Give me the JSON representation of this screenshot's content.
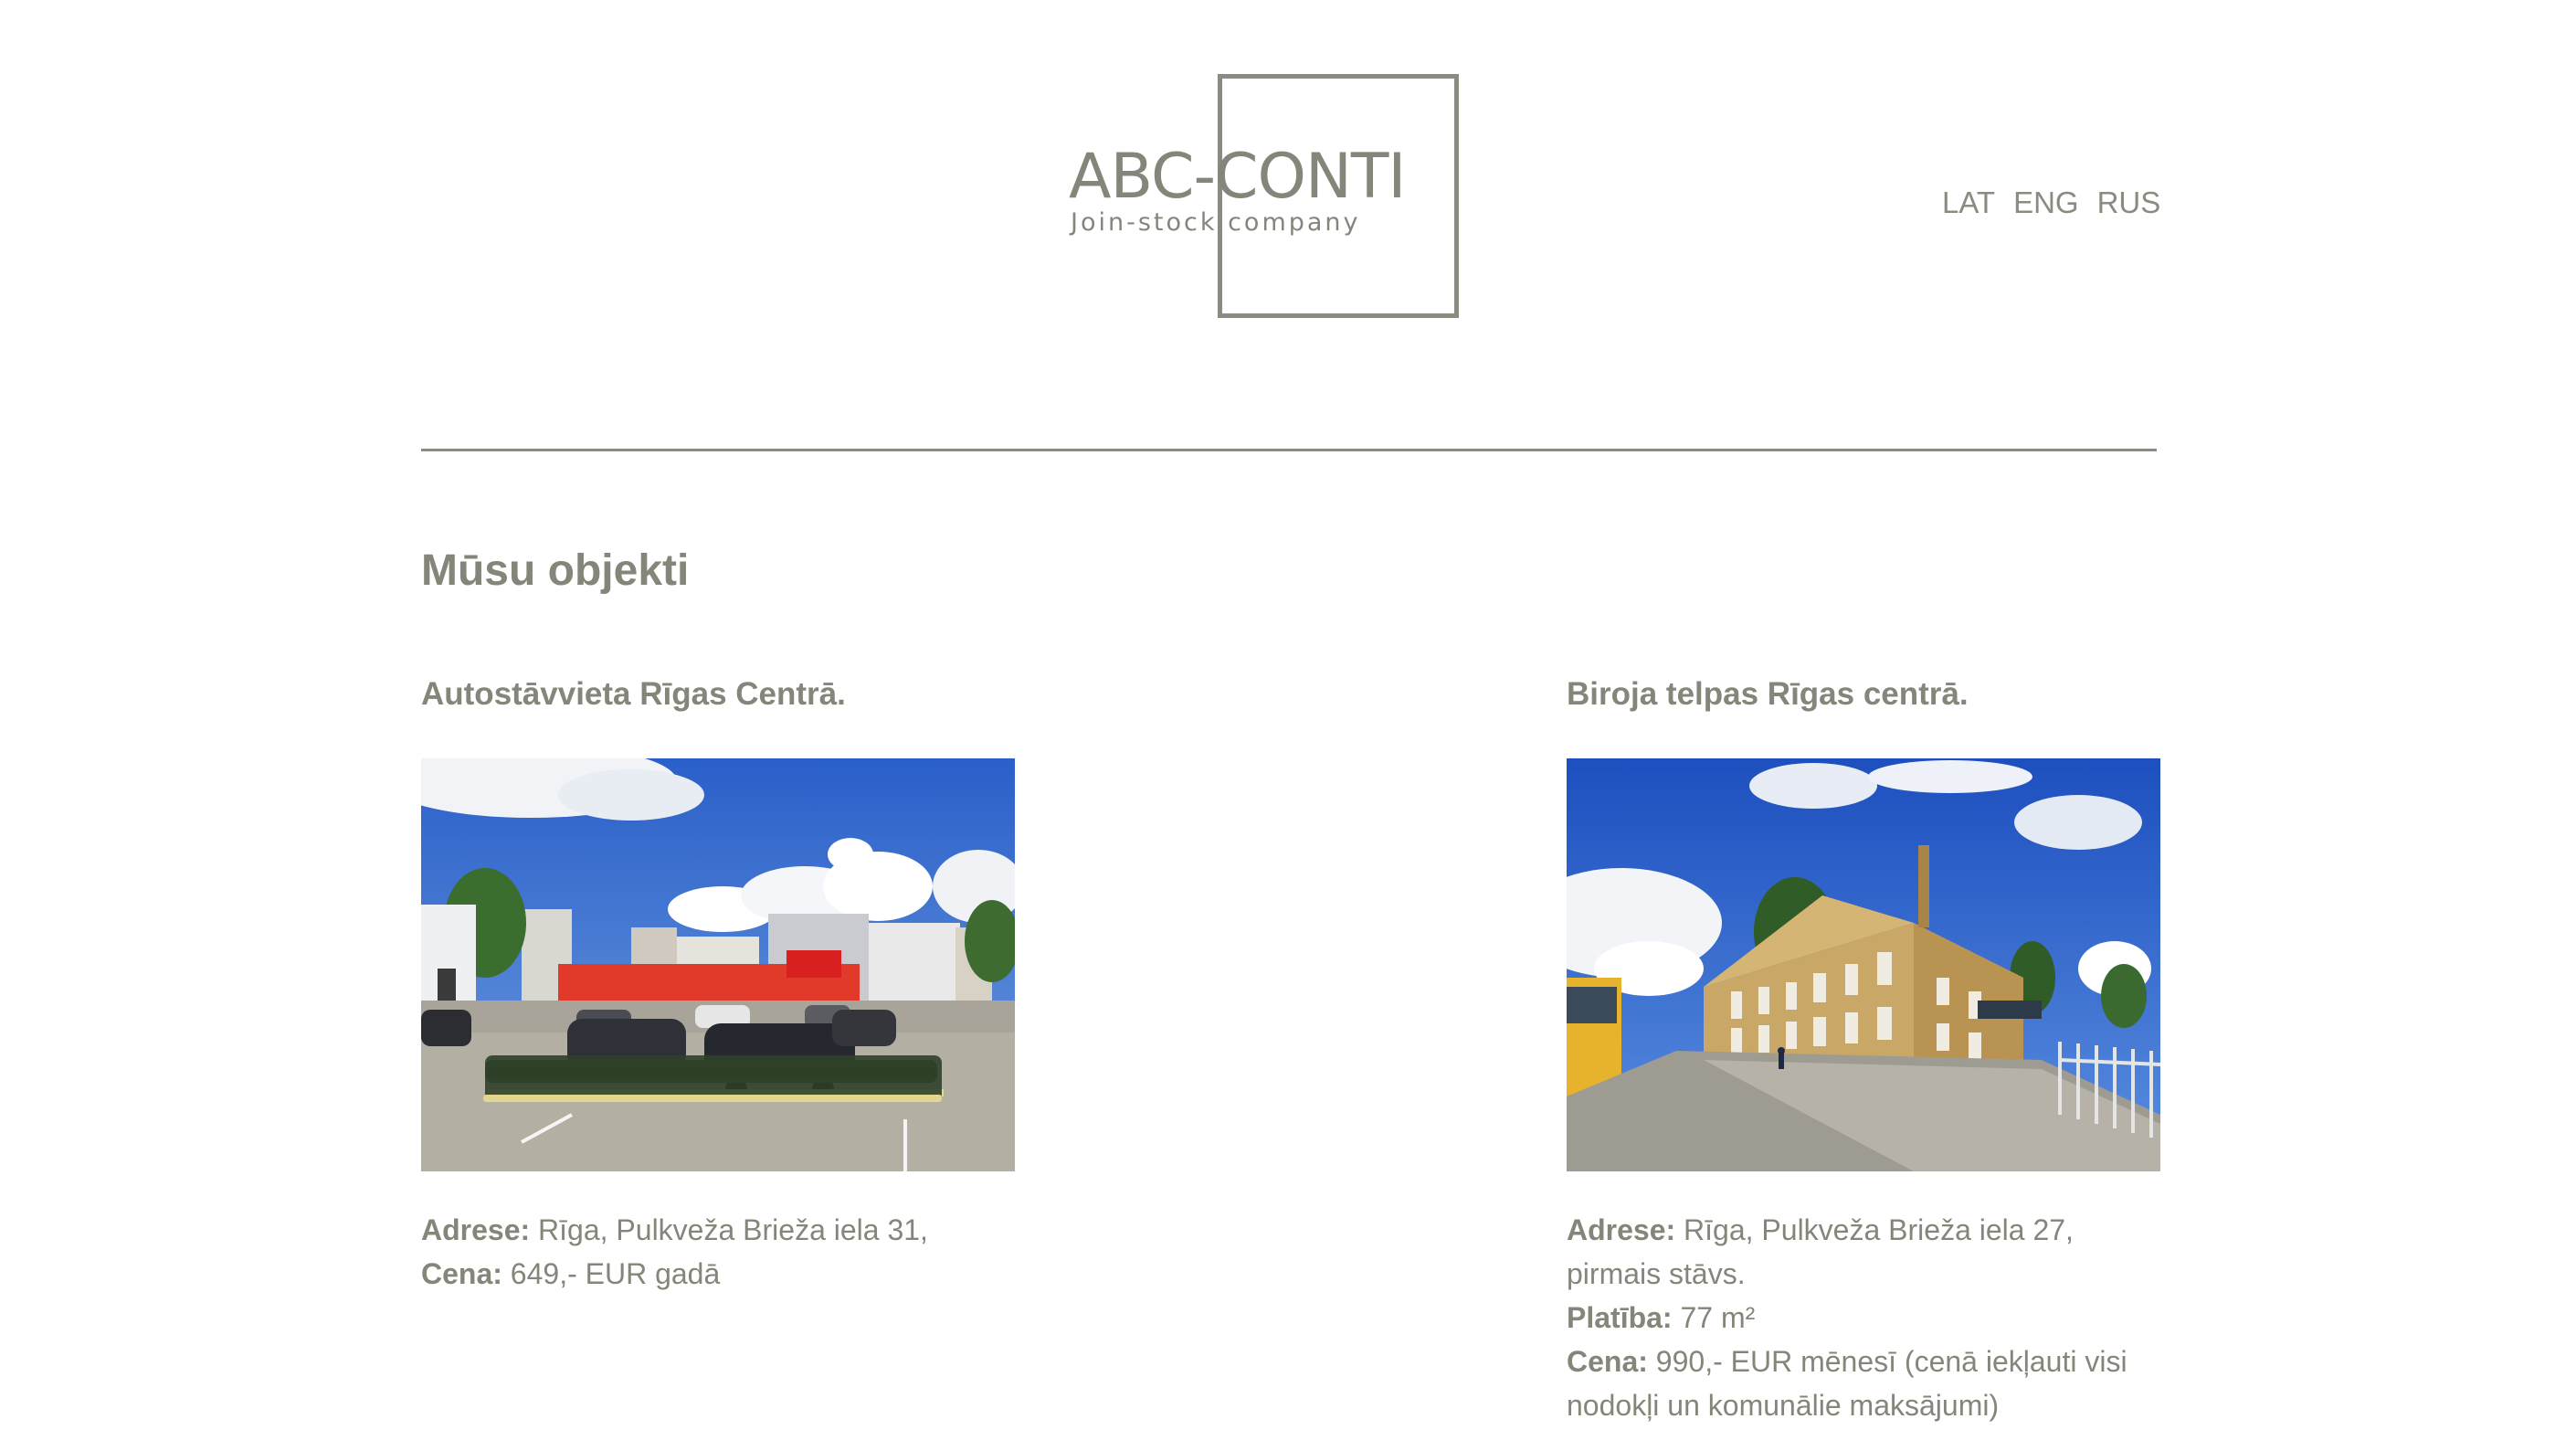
{
  "logo": {
    "name": "ABC-CONTI",
    "tagline": "Join-stock company"
  },
  "nav": {
    "languages": [
      "LAT",
      "ENG",
      "RUS"
    ]
  },
  "page": {
    "title": "Mūsu objekti"
  },
  "properties": [
    {
      "title": "Autostāvvieta Rīgas Centrā.",
      "photo_icon": "parking-lot-photo",
      "address_label": "Adrese:",
      "address_value": "Rīga, Pulkveža Brieža iela 31,",
      "price_label": "Cena:",
      "price_value": "649,- EUR gadā"
    },
    {
      "title": "Biroja telpas Rīgas centrā.",
      "photo_icon": "office-building-photo",
      "address_label": "Adrese:",
      "address_value": "Rīga, Pulkveža Brieža iela 27, pirmais stāvs.",
      "area_label": "Platība:",
      "area_value": "77 m²",
      "price_label": "Cena:",
      "price_value": "990,- EUR mēnesī (cenā iekļauti visi nodokļi un komunālie maksājumi)"
    }
  ],
  "colors": {
    "text": "#85857a",
    "border": "#8b8b80",
    "background": "#ffffff"
  }
}
